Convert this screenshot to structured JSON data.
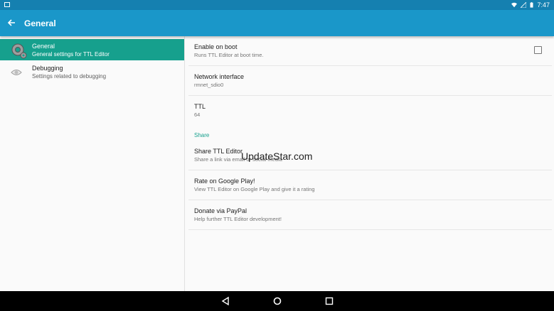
{
  "status_bar": {
    "time": "7:47",
    "icons": [
      "notification-icon",
      "wifi-icon",
      "signal-icon",
      "battery-icon"
    ]
  },
  "app_bar": {
    "title": "General",
    "back_icon": "back-arrow-icon"
  },
  "sidebar": {
    "items": [
      {
        "title": "General",
        "subtitle": "General settings for TTL Editor",
        "icon": "gear-icon",
        "active": true
      },
      {
        "title": "Debugging",
        "subtitle": "Settings related to debugging",
        "icon": "eye-icon",
        "active": false
      }
    ]
  },
  "prefs": {
    "enable_on_boot": {
      "title": "Enable on boot",
      "summary": "Runs TTL Editor at boot time.",
      "checked": false
    },
    "network_interface": {
      "title": "Network interface",
      "summary": "rmnet_sdio0"
    },
    "ttl": {
      "title": "TTL",
      "summary": "64"
    },
    "share_category": "Share",
    "share": {
      "title": "Share TTL Editor",
      "summary": "Share a link via email or social media"
    },
    "rate": {
      "title": "Rate on Google Play!",
      "summary": "View TTL Editor on Google Play and give it a rating"
    },
    "donate": {
      "title": "Donate via PayPal",
      "summary": "Help further TTL Editor development!"
    }
  },
  "watermark": "UpdateStar.com",
  "nav_bar": {
    "icons": [
      "back-triangle-icon",
      "home-circle-icon",
      "recents-square-icon"
    ]
  },
  "colors": {
    "status_bar": "#1580b0",
    "app_bar": "#1a97c9",
    "accent": "#16a08d"
  }
}
